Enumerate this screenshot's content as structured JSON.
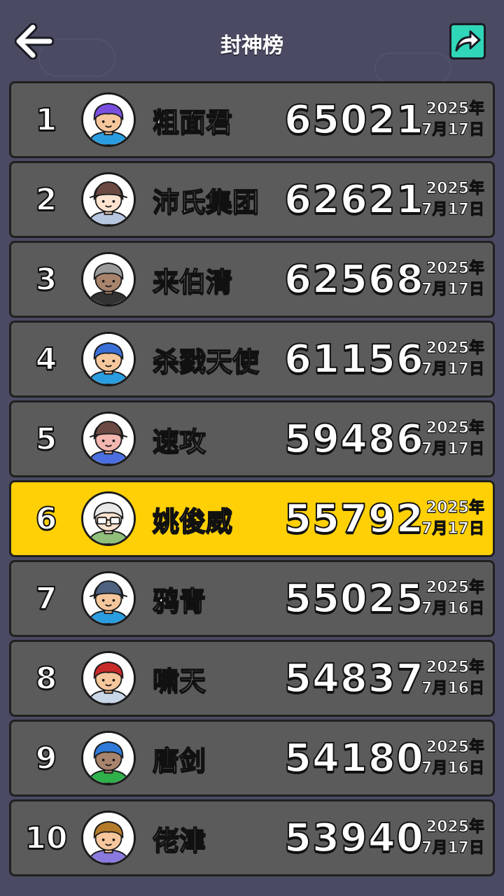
{
  "header": {
    "title": "封神榜",
    "back_icon": "back-arrow-icon",
    "share_icon": "share-arrow-icon",
    "share_color": "#2fd6b8"
  },
  "colors": {
    "background": "#4b4a63",
    "row": "#5b5b5b",
    "row_highlight": "#fed005"
  },
  "leaderboard": [
    {
      "rank": "1",
      "name": "粗面君",
      "score": "65021",
      "year": "2025年",
      "day": "7月17日",
      "highlight": false,
      "avatar": {
        "hair": "#7a4fe0",
        "skin": "#f6c79c",
        "shirt": "#2a9de0",
        "hat": "",
        "glasses": false
      }
    },
    {
      "rank": "2",
      "name": "沛氏集团",
      "score": "62621",
      "year": "2025年",
      "day": "7月17日",
      "highlight": false,
      "avatar": {
        "hair": "#6b4a43",
        "skin": "#fde3cf",
        "shirt": "#b8c7e0",
        "hat": "#6b4a43",
        "glasses": false
      }
    },
    {
      "rank": "3",
      "name": "来伯清",
      "score": "62568",
      "year": "2025年",
      "day": "7月17日",
      "highlight": false,
      "avatar": {
        "hair": "#9a9a9a",
        "skin": "#a8846c",
        "shirt": "#333333",
        "hat": "",
        "glasses": false
      }
    },
    {
      "rank": "4",
      "name": "杀戮天使",
      "score": "61156",
      "year": "2025年",
      "day": "7月17日",
      "highlight": false,
      "avatar": {
        "hair": "#3b6fd8",
        "skin": "#f6c79c",
        "shirt": "#2a9de0",
        "hat": "",
        "glasses": false
      }
    },
    {
      "rank": "5",
      "name": "速攻",
      "score": "59486",
      "year": "2025年",
      "day": "7月17日",
      "highlight": false,
      "avatar": {
        "hair": "#6b4a43",
        "skin": "#f4b7b0",
        "shirt": "#4b6fe0",
        "hat": "#6b4a43",
        "glasses": false
      }
    },
    {
      "rank": "6",
      "name": "姚俊威",
      "score": "55792",
      "year": "2025年",
      "day": "7月17日",
      "highlight": true,
      "avatar": {
        "hair": "#e8e8e8",
        "skin": "#fde3cf",
        "shirt": "#8fbf7a",
        "hat": "",
        "glasses": true
      }
    },
    {
      "rank": "7",
      "name": "鸦青",
      "score": "55025",
      "year": "2025年",
      "day": "7月16日",
      "highlight": false,
      "avatar": {
        "hair": "#4e6280",
        "skin": "#f6c79c",
        "shirt": "#2a9de0",
        "hat": "#4e6280",
        "glasses": false
      }
    },
    {
      "rank": "8",
      "name": "啸天",
      "score": "54837",
      "year": "2025年",
      "day": "7月16日",
      "highlight": false,
      "avatar": {
        "hair": "#c82a2a",
        "skin": "#f6c79c",
        "shirt": "#c9d6e8",
        "hat": "",
        "glasses": false
      }
    },
    {
      "rank": "9",
      "name": "唐剑",
      "score": "54180",
      "year": "2025年",
      "day": "7月16日",
      "highlight": false,
      "avatar": {
        "hair": "#2f7ad8",
        "skin": "#a8846c",
        "shirt": "#2fb04a",
        "hat": "",
        "glasses": false
      }
    },
    {
      "rank": "10",
      "name": "佬津",
      "score": "53940",
      "year": "2025年",
      "day": "7月17日",
      "highlight": false,
      "avatar": {
        "hair": "#b47b2a",
        "skin": "#f6c79c",
        "shirt": "#8a7ae0",
        "hat": "",
        "glasses": false
      }
    }
  ]
}
